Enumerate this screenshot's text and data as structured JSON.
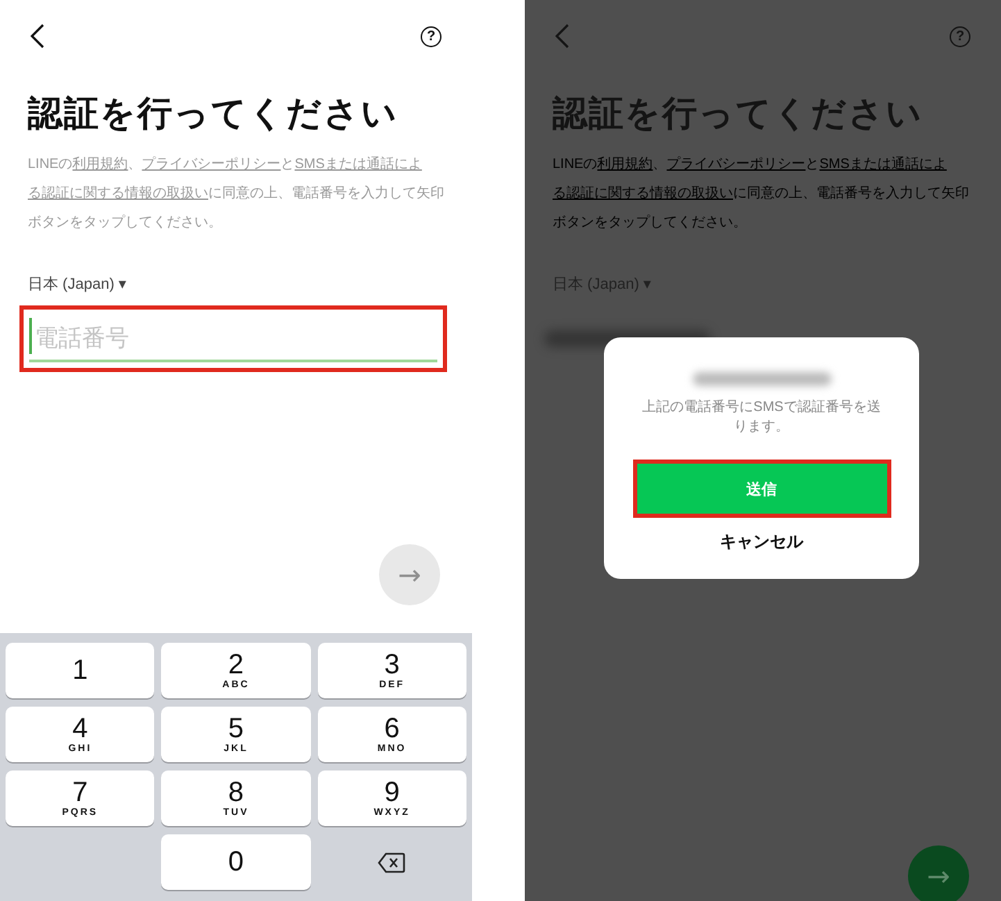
{
  "screens": [
    {
      "dimmed": false,
      "help_label": "?",
      "title": "認証を行ってください",
      "description": [
        {
          "text": "LINEの",
          "link": false
        },
        {
          "text": "利用規約",
          "link": true
        },
        {
          "text": "、",
          "link": false
        },
        {
          "text": "プライバシーポリシー",
          "link": true
        },
        {
          "text": "と",
          "link": false
        },
        {
          "text": "SMSまたは通話によ",
          "link": true
        },
        {
          "text": "る認証に関する情報の取扱い",
          "link": true
        },
        {
          "text": "に同意の上、電話番号を入力して矢印ボタンをタップしてください。",
          "link": false
        }
      ],
      "country": "日本 (Japan)",
      "country_caret": "▾",
      "phone_field": {
        "placeholder": "電話番号",
        "filled": false,
        "highlighted": true
      },
      "next_button": {
        "label": "→",
        "enabled": false
      },
      "keypad": [
        {
          "kind": "digit",
          "digit": "1"
        },
        {
          "kind": "digit",
          "digit": "2",
          "letters": "ABC"
        },
        {
          "kind": "digit",
          "digit": "3",
          "letters": "DEF"
        },
        {
          "kind": "digit",
          "digit": "4",
          "letters": "GHI"
        },
        {
          "kind": "digit",
          "digit": "5",
          "letters": "JKL"
        },
        {
          "kind": "digit",
          "digit": "6",
          "letters": "MNO"
        },
        {
          "kind": "digit",
          "digit": "7",
          "letters": "PQRS"
        },
        {
          "kind": "digit",
          "digit": "8",
          "letters": "TUV"
        },
        {
          "kind": "digit",
          "digit": "9",
          "letters": "WXYZ"
        },
        {
          "kind": "blank"
        },
        {
          "kind": "digit",
          "digit": "0"
        },
        {
          "kind": "delete"
        }
      ]
    },
    {
      "dimmed": true,
      "help_label": "?",
      "title": "認証を行ってください",
      "description": [
        {
          "text": "LINEの",
          "link": false
        },
        {
          "text": "利用規約",
          "link": true
        },
        {
          "text": "、",
          "link": false
        },
        {
          "text": "プライバシーポリシー",
          "link": true
        },
        {
          "text": "と",
          "link": false
        },
        {
          "text": "SMSまたは通話によ",
          "link": true
        },
        {
          "text": "る認証に関する情報の取扱い",
          "link": true
        },
        {
          "text": "に同意の上、電話番号を入力して矢印ボタンをタップしてください。",
          "link": false
        }
      ],
      "country": "日本 (Japan)",
      "country_caret": "▾",
      "phone_field": {
        "filled": true
      },
      "next_button": {
        "label": "→",
        "enabled": true
      },
      "dialog": {
        "message": "上記の電話番号にSMSで認証番号を送ります。",
        "buttons": [
          {
            "label": "送信",
            "kind": "primary",
            "highlighted": true
          },
          {
            "label": "キャンセル",
            "kind": "text",
            "highlighted": false
          }
        ]
      }
    }
  ]
}
